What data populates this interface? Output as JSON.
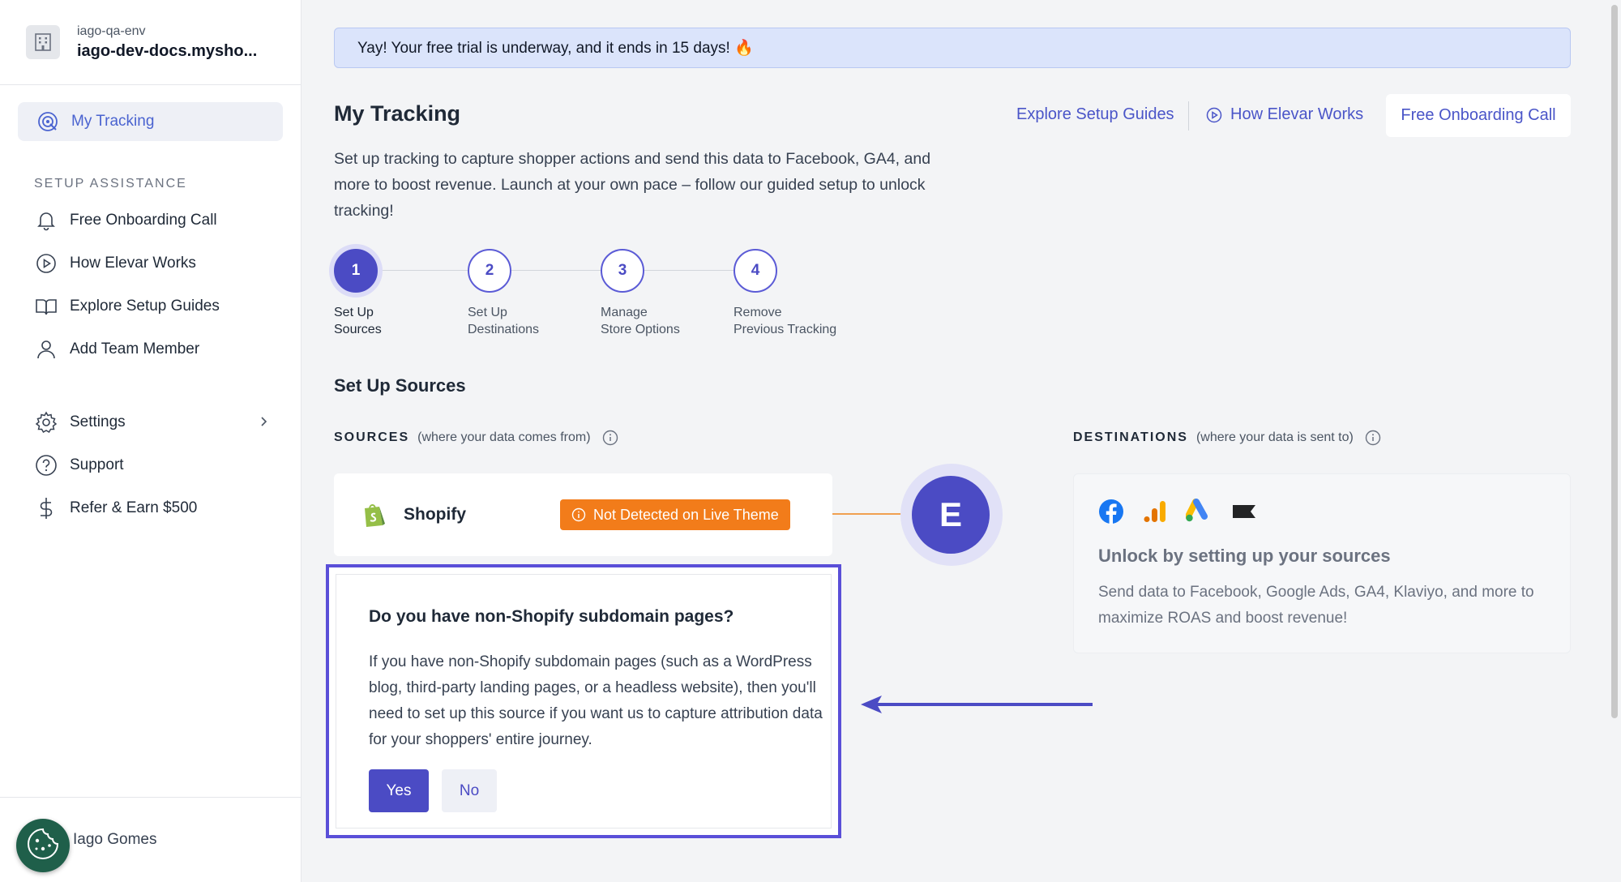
{
  "store": {
    "env": "iago-qa-env",
    "name": "iago-dev-docs.mysho..."
  },
  "sidebar": {
    "active_item": "My Tracking",
    "section_label": "SETUP ASSISTANCE",
    "items": [
      {
        "label": "Free Onboarding Call",
        "icon": "bell-icon"
      },
      {
        "label": "How Elevar Works",
        "icon": "play-circle-icon"
      },
      {
        "label": "Explore Setup Guides",
        "icon": "book-icon"
      },
      {
        "label": "Add Team Member",
        "icon": "user-icon"
      }
    ],
    "bottom_items": [
      {
        "label": "Settings",
        "icon": "gear-icon"
      },
      {
        "label": "Support",
        "icon": "question-circle-icon"
      },
      {
        "label": "Refer & Earn $500",
        "icon": "dollar-icon"
      }
    ],
    "user_name": "Iago Gomes"
  },
  "banner": {
    "text": "Yay! Your free trial is underway, and it ends in 15 days! 🔥"
  },
  "page": {
    "title": "My Tracking",
    "links": {
      "guides": "Explore Setup Guides",
      "how": "How Elevar Works",
      "onboarding": "Free Onboarding Call"
    },
    "intro": "Set up tracking to capture shopper actions and send this data to Facebook, GA4, and more to boost revenue. Launch at your own pace – follow our guided setup to unlock tracking!"
  },
  "steps": [
    {
      "num": "1",
      "line1": "Set Up",
      "line2": "Sources",
      "active": true
    },
    {
      "num": "2",
      "line1": "Set Up",
      "line2": "Destinations",
      "active": false
    },
    {
      "num": "3",
      "line1": "Manage",
      "line2": "Store Options",
      "active": false
    },
    {
      "num": "4",
      "line1": "Remove",
      "line2": "Previous Tracking",
      "active": false
    }
  ],
  "section": {
    "title": "Set Up Sources",
    "sources_label": "SOURCES",
    "sources_hint": "(where your data comes from)",
    "destinations_label": "DESTINATIONS",
    "destinations_hint": "(where your data is sent to)"
  },
  "source": {
    "name": "Shopify",
    "badge": "Not Detected on Live Theme"
  },
  "hub": {
    "letter": "E"
  },
  "destinations": {
    "title": "Unlock by setting up your sources",
    "desc": "Send data to Facebook, Google Ads, GA4, Klaviyo, and more to maximize ROAS and boost revenue!"
  },
  "question": {
    "title": "Do you have non-Shopify subdomain pages?",
    "text": "If you have non-Shopify subdomain pages (such as a WordPress blog, third-party landing pages, or a headless website), then you'll need to set up this source if you want us to capture attribution data for your shoppers' entire journey.",
    "yes": "Yes",
    "no": "No"
  },
  "colors": {
    "accent": "#4b4bc4",
    "warning": "#f27c1a",
    "link": "#4a55c8"
  }
}
